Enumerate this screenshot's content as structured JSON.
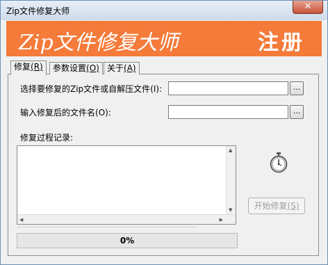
{
  "window": {
    "title": "Zip文件修复大师",
    "close_label": "✕"
  },
  "banner": {
    "title": "Zip文件修复大师",
    "register": "注册",
    "color": "#f47b3a"
  },
  "tabs": [
    {
      "label": "修复",
      "hotkey": "(R)",
      "active": true
    },
    {
      "label": "参数设置",
      "hotkey": "(O)",
      "active": false
    },
    {
      "label": "关于",
      "hotkey": "(A)",
      "active": false
    }
  ],
  "form": {
    "select_file_label": "选择要修复的Zip文件或自解压文件",
    "select_file_hotkey": "(I):",
    "select_file_value": "",
    "output_name_label": "输入修复后的文件名",
    "output_name_hotkey": "(O):",
    "output_name_value": "",
    "browse_label": "...",
    "log_label": "修复过程记录:"
  },
  "actions": {
    "start_label": "开始修复",
    "start_hotkey": "(S)",
    "start_enabled": false
  },
  "progress": {
    "value": 0,
    "text": "0%"
  },
  "icons": {
    "close": "close-icon",
    "stopwatch": "stopwatch-icon"
  }
}
